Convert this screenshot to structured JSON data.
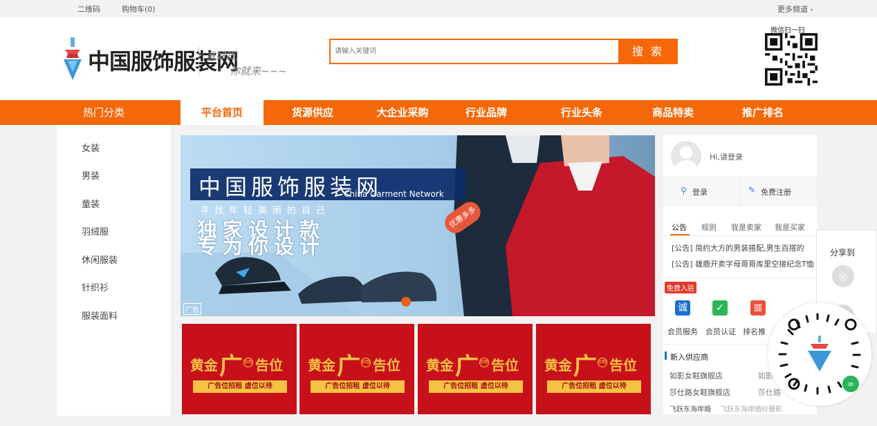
{
  "topbar": {
    "qrcode": "二维码",
    "cart": "购物车(0)",
    "more_channels": "更多频道"
  },
  "header": {
    "site_name": "中国服饰服装网",
    "slogan_line1": "我好货,",
    "slogan_line2": "你就来~~~",
    "search_placeholder": "请输入关键词",
    "search_button": "搜 索",
    "wechat_scan": "微信扫一扫"
  },
  "nav": {
    "hot_category": "热门分类",
    "items": [
      "平台首页",
      "货源供应",
      "大企业采购",
      "行业品牌",
      "行业头条",
      "商品特卖",
      "推广排名"
    ],
    "active_index": 0
  },
  "sidebar": {
    "items": [
      "女装",
      "男装",
      "童装",
      "羽绒服",
      "休闲服装",
      "针织衫",
      "服装面料"
    ]
  },
  "banner": {
    "title_cn": "中国服饰服装网",
    "title_en": "China Garment Network",
    "tagline": "寻找年轻美丽的自己",
    "promo1": "独家设计款",
    "promo2": "专为你设计",
    "badge": "优惠多多",
    "ad_label": "广告"
  },
  "ads": {
    "title_left": "黄金",
    "title_mid": "广",
    "title_right": "告位",
    "circle": "招租",
    "subtitle": "广告位招租 虚位以待",
    "count": 4
  },
  "user_panel": {
    "greeting": "Hi,请登录",
    "login": "登录",
    "register": "免费注册",
    "tabs": [
      "公告",
      "规则",
      "我是卖家",
      "我是买家"
    ],
    "notices": [
      "[公告] 简约大方的男装搭配,男生百搭的",
      "[公告] 雄鹿开卖字母哥哥库里空接纪念T恤"
    ],
    "free_join": "免费入驻",
    "services": [
      {
        "icon": "诚",
        "label": "会员服务",
        "color": "#1a6fd1"
      },
      {
        "icon": "✓",
        "label": "会员认证",
        "color": "#2bb35a"
      },
      {
        "icon": "▥",
        "label": "排名推",
        "color": "#e8513a"
      }
    ],
    "new_suppliers_title": "新入供应商",
    "suppliers": [
      [
        "如影女鞋旗舰店",
        "如影"
      ],
      [
        "莎仕路女鞋旗舰店",
        "莎仕路"
      ],
      [
        "飞跃东海岸婚",
        "飞跃东海岸婚纱摄影"
      ]
    ]
  },
  "share": {
    "title": "分享到",
    "icons": [
      "weibo-icon",
      "qq-icon"
    ]
  },
  "colors": {
    "brand_orange": "#f4680a",
    "ad_red": "#c8101a",
    "gold": "#f5c242"
  }
}
